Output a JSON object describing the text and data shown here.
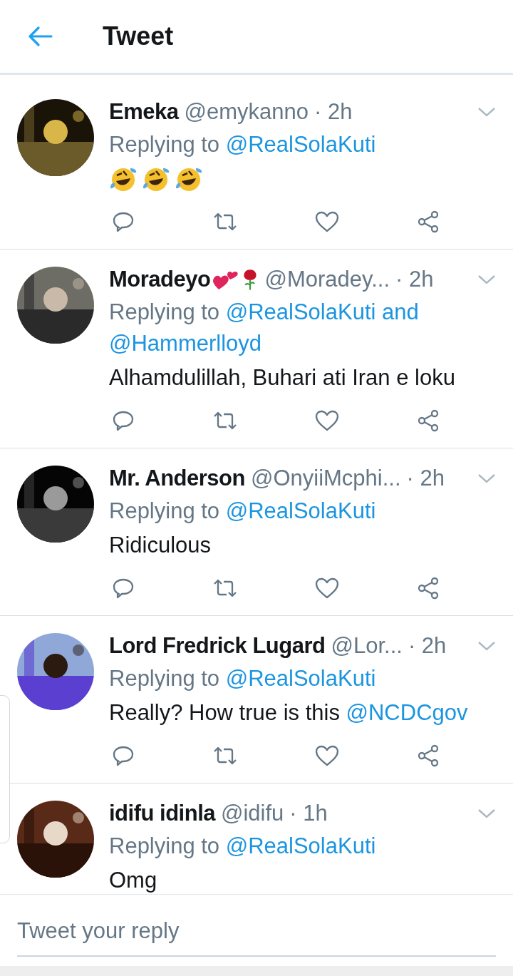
{
  "header": {
    "title": "Tweet"
  },
  "tweets": [
    {
      "name": "Emeka",
      "handle": "@emykanno",
      "time": "· 2h",
      "replying_label": "Replying to",
      "replying_mentions": [
        "@RealSolaKuti"
      ],
      "body": [
        {
          "kind": "laugh"
        },
        {
          "kind": "laugh"
        },
        {
          "kind": "laugh"
        }
      ]
    },
    {
      "name": "Moradeyo",
      "name_emojis": [
        {
          "kind": "hearts"
        },
        {
          "kind": "rose"
        }
      ],
      "handle": "@Moradey...",
      "time": "· 2h",
      "replying_label": "Replying to",
      "replying_mentions": [
        "@RealSolaKuti",
        "@Hammerlloyd"
      ],
      "replying_joiner": "and",
      "body": [
        {
          "kind": "text",
          "text": "Alhamdulillah, Buhari ati Iran e loku"
        }
      ]
    },
    {
      "name": "Mr. Anderson",
      "handle": "@OnyiiMcphi...",
      "time": "· 2h",
      "replying_label": "Replying to",
      "replying_mentions": [
        "@RealSolaKuti"
      ],
      "body": [
        {
          "kind": "text",
          "text": "Ridiculous"
        }
      ]
    },
    {
      "name": "Lord Fredrick Lugard",
      "handle": "@Lor...",
      "time": "· 2h",
      "replying_label": "Replying to",
      "replying_mentions": [
        "@RealSolaKuti"
      ],
      "body": [
        {
          "kind": "text",
          "text": "Really? How true is this "
        },
        {
          "kind": "mention",
          "text": "@NCDCgov"
        }
      ]
    },
    {
      "name": "idifu idinla",
      "handle": "@idifu",
      "time": "· 1h",
      "replying_label": "Replying to",
      "replying_mentions": [
        "@RealSolaKuti"
      ],
      "body": [
        {
          "kind": "text",
          "text": "Omg"
        }
      ]
    }
  ],
  "reply_bar": {
    "placeholder": "Tweet your reply"
  }
}
